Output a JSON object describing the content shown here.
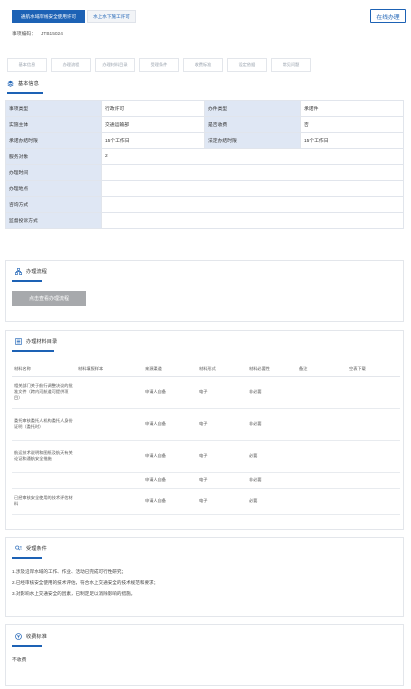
{
  "header": {
    "primary_button": "通航水域岸线安全使用许可",
    "secondary_button": "水上水下施工许可",
    "consult_button": "在线办理",
    "code_label": "事项编码：",
    "code_value": "JTB15024"
  },
  "tabs": [
    "基本信息",
    "办理流程",
    "办理材料目录",
    "受理条件",
    "收费标准",
    "设定依据",
    "常见问题"
  ],
  "basic_info": {
    "title": "基本信息",
    "rows": [
      [
        "事项类型",
        "行政许可",
        "办件类型",
        "承诺件"
      ],
      [
        "实施主体",
        "交通运输部",
        "是否收费",
        "否"
      ],
      [
        "承诺办结时限",
        "15个工作日",
        "法定办结时限",
        "15个工作日"
      ],
      [
        "服务对象",
        "2",
        "",
        ""
      ],
      [
        "办理时间",
        "",
        "",
        ""
      ],
      [
        "办理地点",
        "",
        "",
        ""
      ],
      [
        "咨询方式",
        "",
        "",
        ""
      ],
      [
        "监督投诉方式",
        "",
        "",
        ""
      ]
    ]
  },
  "flow": {
    "title": "办理流程",
    "button": "点击查看办理流程"
  },
  "materials": {
    "title": "办理材料目录",
    "headers": [
      "材料名称",
      "材料填报样本",
      "来源渠道",
      "材料形式",
      "材料必要性",
      "备注",
      "空表下载"
    ],
    "rows": [
      [
        "相关部门关于航行调整决议的批准文件（跨内河航道可提供项目）",
        "",
        "申请人自备",
        "电子",
        "非必要",
        "",
        ""
      ],
      [
        "委托审核委托人机构委托人身份证明（委托时）",
        "",
        "申请人自备",
        "电子",
        "非必要",
        "",
        ""
      ],
      [
        "航运技术说明和图纸及航天有关论证和通航安全措施",
        "",
        "申请人自备",
        "电子",
        "必要",
        "",
        ""
      ],
      [
        "",
        "",
        "申请人自备",
        "电子",
        "非必要",
        "",
        ""
      ],
      [
        "已经审核安全使用的技术评估材料",
        "",
        "申请人自备",
        "电子",
        "必要",
        "",
        ""
      ]
    ]
  },
  "conditions": {
    "title": "受理条件",
    "items": [
      "1.涉及沿岸水域的工作、作业、活动已完成可行性研究；",
      "2.已经审核安全使用的技术评估，符合水上交通安全的技术规范和要求；",
      "3.对影响水上交通安全的因素，已制定足以消除影响的措施。"
    ]
  },
  "fee": {
    "title": "收费标准",
    "text": "不收费"
  },
  "colors": {
    "accent": "#1d62b5",
    "table_key_bg": "#dfe7f4",
    "border": "#e3e6eb"
  }
}
